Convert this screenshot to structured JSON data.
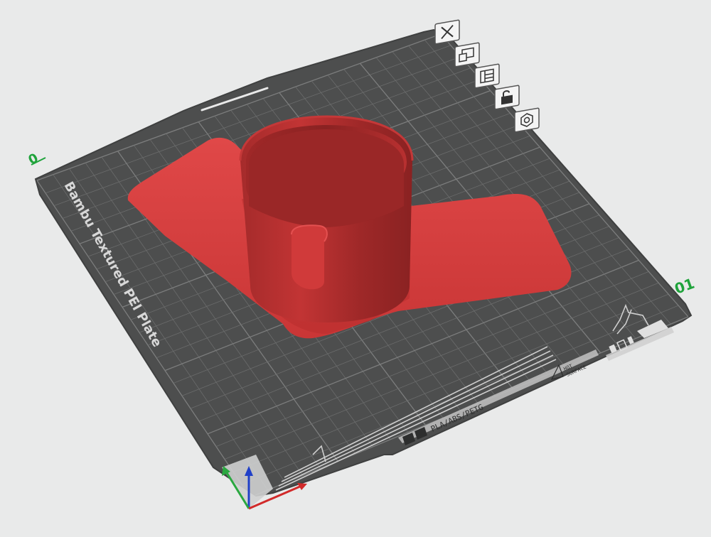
{
  "viewport": {
    "background": "#e9eaea"
  },
  "plate": {
    "brand_label": "Bambu Textured PEI Plate",
    "plate_number": "01",
    "slot_marker": "0",
    "material_label": "PLA/ABS/PETG",
    "hot_surface_line1": "HOT",
    "hot_surface_line2": "SURFACE",
    "colors": {
      "plate": "#4d4e4e",
      "plate_edge": "#3f4040",
      "grid": "#6b6c6c",
      "grid_major": "#7c7d7d",
      "accent_green": "#1fa33b"
    }
  },
  "model": {
    "color": "#d83c3c",
    "shade": "#a02626"
  },
  "plate_toolbar": {
    "items": [
      {
        "name": "remove-plate-icon"
      },
      {
        "name": "pick-plate-icon"
      },
      {
        "name": "arrange-plate-icon"
      },
      {
        "name": "lock-plate-icon"
      },
      {
        "name": "plate-settings-icon"
      }
    ]
  },
  "axes": {
    "x_color": "#d12a2a",
    "y_color": "#2aa840",
    "z_color": "#2040c8"
  }
}
